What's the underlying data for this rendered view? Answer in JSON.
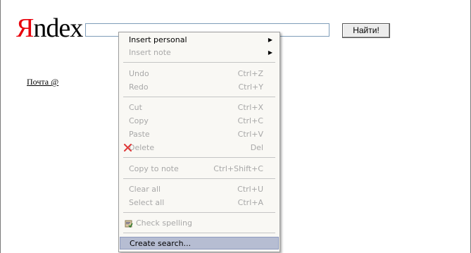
{
  "page": {
    "logo_first": "Я",
    "logo_rest": "ndex",
    "search_value": "",
    "search_button": "Найти!",
    "mail_link": "Почта @",
    "accent_color": "#e8000b"
  },
  "menu": {
    "insert_personal": "Insert personal",
    "insert_note": "Insert note",
    "undo": "Undo",
    "undo_sc": "Ctrl+Z",
    "redo": "Redo",
    "redo_sc": "Ctrl+Y",
    "cut": "Cut",
    "cut_sc": "Ctrl+X",
    "copy": "Copy",
    "copy_sc": "Ctrl+C",
    "paste": "Paste",
    "paste_sc": "Ctrl+V",
    "delete": "Delete",
    "delete_sc": "Del",
    "copy_to_note": "Copy to note",
    "copy_to_note_sc": "Ctrl+Shift+C",
    "clear_all": "Clear all",
    "clear_all_sc": "Ctrl+U",
    "select_all": "Select all",
    "select_all_sc": "Ctrl+A",
    "check_spelling": "Check spelling",
    "create_search": "Create search...",
    "highlight_color": "#b6bdd2"
  }
}
